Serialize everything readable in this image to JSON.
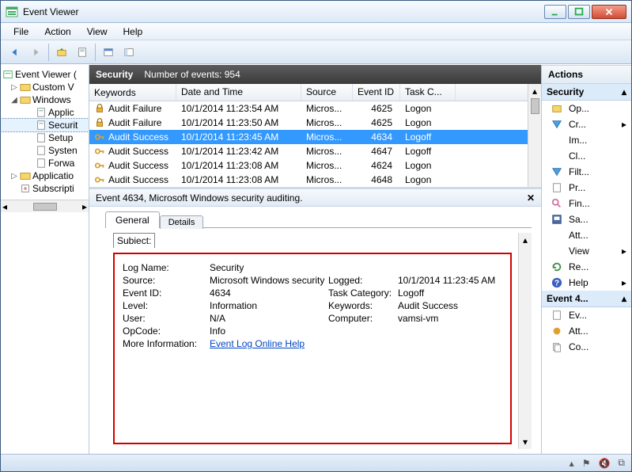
{
  "titlebar": {
    "title": "Event Viewer"
  },
  "menu": [
    "File",
    "Action",
    "View",
    "Help"
  ],
  "tree": {
    "root": "Event Viewer (",
    "custom": "Custom V",
    "windows": "Windows",
    "applic": "Applic",
    "security": "Securit",
    "setup": "Setup",
    "system": "Systen",
    "forwarded": "Forwa",
    "applications": "Applicatio",
    "subscript": "Subscripti"
  },
  "grid_header": {
    "name": "Security",
    "count_label": "Number of events: 954"
  },
  "columns": [
    "Keywords",
    "Date and Time",
    "Source",
    "Event ID",
    "Task C..."
  ],
  "rows": [
    {
      "key": "Audit Failure",
      "dt": "10/1/2014 11:23:54 AM",
      "src": "Micros...",
      "eid": "4625",
      "tc": "Logon",
      "icon": "lock"
    },
    {
      "key": "Audit Failure",
      "dt": "10/1/2014 11:23:50 AM",
      "src": "Micros...",
      "eid": "4625",
      "tc": "Logon",
      "icon": "lock"
    },
    {
      "key": "Audit Success",
      "dt": "10/1/2014 11:23:45 AM",
      "src": "Micros...",
      "eid": "4634",
      "tc": "Logoff",
      "icon": "key"
    },
    {
      "key": "Audit Success",
      "dt": "10/1/2014 11:23:42 AM",
      "src": "Micros...",
      "eid": "4647",
      "tc": "Logoff",
      "icon": "key"
    },
    {
      "key": "Audit Success",
      "dt": "10/1/2014 11:23:08 AM",
      "src": "Micros...",
      "eid": "4624",
      "tc": "Logon",
      "icon": "key"
    },
    {
      "key": "Audit Success",
      "dt": "10/1/2014 11:23:08 AM",
      "src": "Micros...",
      "eid": "4648",
      "tc": "Logon",
      "icon": "key"
    }
  ],
  "selected_row": 2,
  "detail_header": "Event 4634, Microsoft Windows security auditing.",
  "tabs": {
    "general": "General",
    "details": "Details"
  },
  "subject_label": "Subiect:",
  "detail": {
    "log_name_k": "Log Name:",
    "log_name": "Security",
    "source_k": "Source:",
    "source": "Microsoft Windows security",
    "logged_k": "Logged:",
    "logged": "10/1/2014 11:23:45 AM",
    "eventid_k": "Event ID:",
    "eventid": "4634",
    "taskcat_k": "Task Category:",
    "taskcat": "Logoff",
    "level_k": "Level:",
    "level": "Information",
    "keywords_k": "Keywords:",
    "keywords": "Audit Success",
    "user_k": "User:",
    "user": "N/A",
    "computer_k": "Computer:",
    "computer": "vamsi-vm",
    "opcode_k": "OpCode:",
    "opcode": "Info",
    "moreinfo_k": "More Information:",
    "moreinfo": "Event Log Online Help"
  },
  "actions": {
    "title": "Actions",
    "group1": "Security",
    "items1": [
      "Op...",
      "Cr...",
      "Im...",
      "Cl...",
      "Filt...",
      "Pr...",
      "Fin...",
      "Sa...",
      "Att...",
      "View",
      "Re...",
      "Help"
    ],
    "group2": "Event 4...",
    "items2": [
      "Ev...",
      "Att...",
      "Co..."
    ]
  }
}
